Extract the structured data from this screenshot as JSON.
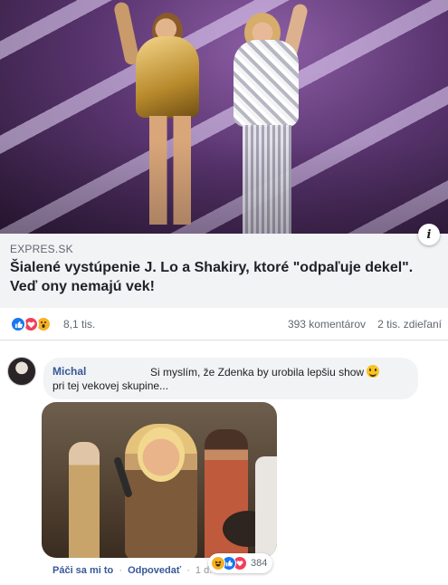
{
  "link_preview": {
    "domain": "EXPRES.SK",
    "headline": "Šialené vystúpenie J. Lo a Shakiry, ktoré \"odpaľuje dekel\". Veď ony nemajú vek!",
    "info_icon": "i"
  },
  "reactions_bar": {
    "icons": [
      "like-icon",
      "love-icon",
      "wow-icon"
    ],
    "reaction_count": "8,1 tis.",
    "comments": "393 komentárov",
    "shares": "2 tis. zdieľaní"
  },
  "comment": {
    "author": "Michal",
    "text_line1": "Si myslím, že Zdenka by urobila lepšiu show",
    "text_line2": "pri tej vekovej skupine...",
    "emoji": "smile-emoji",
    "actions": {
      "like": "Páči sa mi to",
      "separator": "·",
      "reply": "Odpovedať",
      "time": "1 d."
    },
    "reactions": {
      "icons": [
        "haha-icon",
        "like-icon",
        "love-icon"
      ],
      "count": "384"
    }
  },
  "colors": {
    "link_blue": "#385898",
    "like_blue": "#1877f2",
    "love_red": "#f33e58",
    "wow_yellow": "#f7b125",
    "bubble_grey": "#f2f3f5",
    "meta_grey": "#606770"
  }
}
